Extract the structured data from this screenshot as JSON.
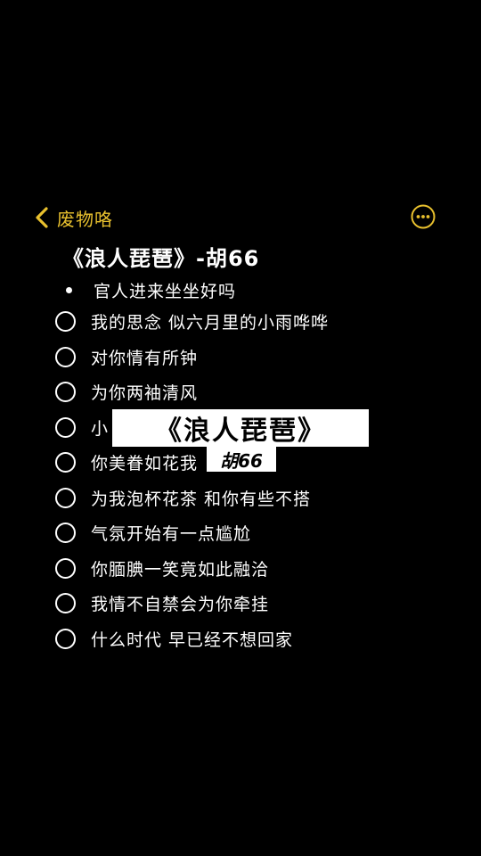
{
  "nav": {
    "back_label": "废物咯",
    "back_icon": "chevron-left-icon",
    "more_icon": "ellipsis-circle-icon",
    "accent_color": "#e9c12e"
  },
  "note": {
    "title": "《浪人琵琶》-胡66",
    "bullet": "官人进来坐坐好吗",
    "items": [
      "我的思念 似六月里的小雨哗哗",
      "对你情有所钟",
      "为你两袖清风",
      "小",
      "你美眷如花我",
      "为我泡杯花茶 和你有些不搭",
      "气氛开始有一点尴尬",
      "你腼腆一笑竟如此融洽",
      "我情不自禁会为你牵挂",
      "什么时代 早已经不想回家"
    ]
  },
  "overlay": {
    "title": "《浪人琵琶》",
    "subtitle": "胡66"
  }
}
